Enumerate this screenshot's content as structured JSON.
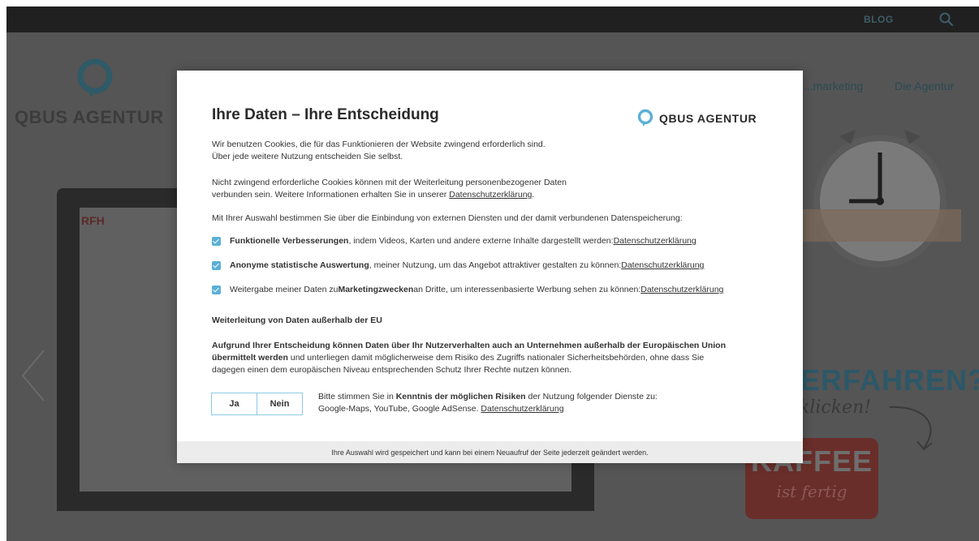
{
  "site": {
    "topbar": {
      "blog_label": "BLOG"
    },
    "logo_text": "QBUS AGENTUR",
    "nav": [
      {
        "label": "...marketing"
      },
      {
        "label": "Die Agentur"
      }
    ],
    "laptop_brand": "RFH",
    "promo": {
      "title": "ERFAHREN?",
      "script": "klicken!",
      "badge_main": "KAFFEE",
      "badge_sub": "ist fertig"
    }
  },
  "modal": {
    "title": "Ihre Daten – Ihre Entscheidung",
    "logo_text": "QBUS AGENTUR",
    "intro_line1": "Wir benutzen Cookies, die für das Funktionieren der Website zwingend erforderlich sind.",
    "intro_line2": "Über jede weitere Nutzung entscheiden Sie selbst.",
    "cookies_line1": "Nicht zwingend erforderliche Cookies können mit der Weiterleitung personenbezogener Daten",
    "cookies_line2_prefix": "verbunden sein. Weitere Informationen erhalten Sie in unserer ",
    "privacy_link": "Datenschutzerklärung",
    "cookies_line2_suffix": ".",
    "choice_intro": "Mit Ihrer Auswahl bestimmen Sie über die Einbindung von externen Diensten und der damit verbundenen Datenspeicherung:",
    "options": [
      {
        "bold": "Funktionelle Verbesserungen",
        "text": ", indem Videos, Karten und andere externe Inhalte dargestellt werden: ",
        "link": "Datenschutzerklärung",
        "checked": true
      },
      {
        "bold": "Anonyme statistische Auswertung",
        "text": ", meiner Nutzung, um das Angebot attraktiver gestalten zu können: ",
        "link": "Datenschutzerklärung",
        "checked": true
      },
      {
        "pre": "Weitergabe meiner Daten zu ",
        "bold": "Marketingzwecken",
        "text": " an Dritte, um interessenbasierte Werbung sehen zu können: ",
        "link": "Datenschutzerklärung",
        "checked": true
      }
    ],
    "eu_heading": "Weiterleitung von Daten außerhalb der EU",
    "risk_bold1": "Aufgrund Ihrer Entscheidung können Daten über Ihr Nutzerverhalten auch an Unternehmen außerhalb der Europäischen Union",
    "risk_bold2": "übermittelt werden",
    "risk_text2": " und unterliegen damit möglicherweise dem Risiko des Zugriffs nationaler Sicherheitsbehörden, ohne dass Sie",
    "risk_text3": "dagegen einen dem europäischen Niveau entsprechenden Schutz Ihrer Rechte nutzen können.",
    "btn_yes": "Ja",
    "btn_no": "Nein",
    "consent_pre": "Bitte stimmen Sie in ",
    "consent_bold": "Kenntnis der möglichen Risiken",
    "consent_post": " der Nutzung folgender Dienste zu:",
    "consent_line2": "Google-Maps, YouTube, Google AdSense. ",
    "consent_link": "Datenschutzerklärung",
    "footer": "Ihre Auswahl wird gespeichert und kann bei einem Neuaufruf der Seite jederzeit geändert werden."
  }
}
